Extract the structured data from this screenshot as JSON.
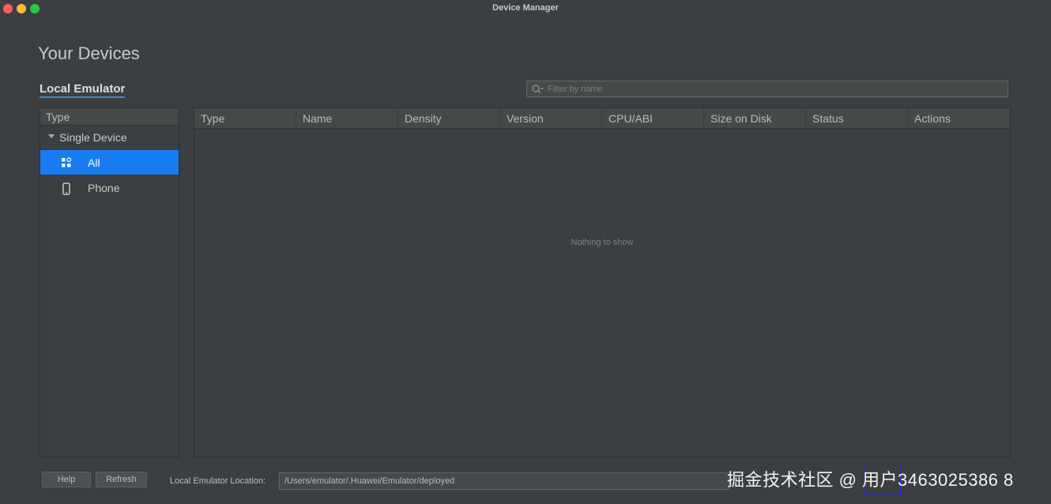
{
  "window": {
    "title": "Device Manager"
  },
  "page": {
    "title": "Your Devices"
  },
  "section_tab": "Local Emulator",
  "filter": {
    "placeholder": "Filter by name"
  },
  "type_panel": {
    "header": "Type",
    "group": "Single Device",
    "items": [
      {
        "label": "All",
        "icon": "grid-icon",
        "selected": true
      },
      {
        "label": "Phone",
        "icon": "phone-icon",
        "selected": false
      }
    ]
  },
  "table": {
    "columns": [
      "Type",
      "Name",
      "Density",
      "Version",
      "CPU/ABI",
      "Size on Disk",
      "Status",
      "Actions"
    ],
    "empty_message": "Nothing to show"
  },
  "footer": {
    "help_label": "Help",
    "refresh_label": "Refresh",
    "location_label": "Local Emulator Location:",
    "location_value": "/Users/emulator/.Huawei/Emulator/deployed"
  },
  "watermark": "掘金技术社区 @ 用户3463025386 8",
  "colors": {
    "background": "#3c3f41",
    "selection": "#1a7cf2",
    "tab_underline": "#4a88c7"
  }
}
